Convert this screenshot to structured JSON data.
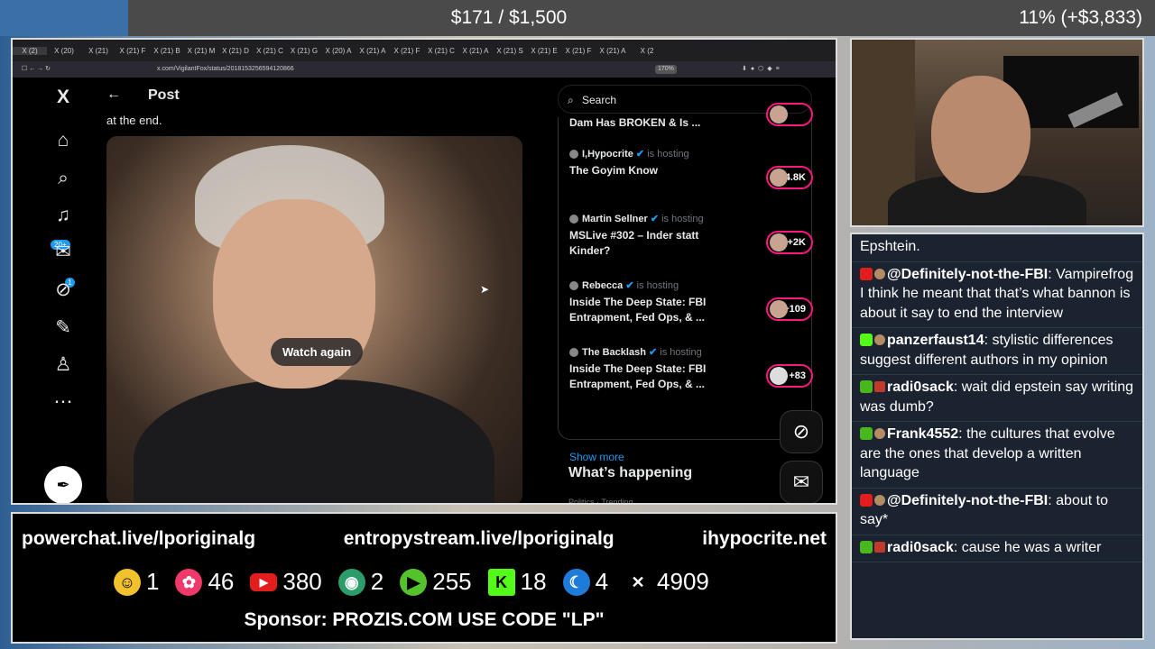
{
  "overlay": {
    "goal": "$171 / $1,500",
    "percent": "11% (+$3,833)"
  },
  "browser": {
    "tabs": [
      "X (2)",
      "X (20)",
      "X (21)",
      "X (21) F",
      "X (21) B",
      "X (21) M",
      "X (21) D",
      "X (21) C",
      "X (21) G",
      "X (20) A",
      "X (21) A",
      "X (21) F",
      "X (21) C",
      "X (21) A",
      "X (21) S",
      "X (21) E",
      "X (21) F",
      "X (21) A",
      "X (2"
    ],
    "url": "x.com/VigilantFox/status/2018153256594120866",
    "zoom": "170%"
  },
  "x": {
    "logo": "X",
    "post_title": "Post",
    "post_text_tail": "at the end.",
    "nav": {
      "notifications_badge": "20+",
      "messages_badge": "1"
    },
    "video": {
      "watch_again": "Watch again"
    },
    "search_placeholder": "Search",
    "spaces": [
      {
        "host": "",
        "hosting": "",
        "title": "Dam Has BROKEN & Is ...",
        "count": ""
      },
      {
        "host": "I,Hypocrite",
        "hosting": "is hosting",
        "title": "The Goyim Know",
        "count": "+4.8K"
      },
      {
        "host": "Martin Sellner",
        "hosting": "is hosting",
        "title": "MSLive #302 – Inder statt Kinder?",
        "count": "+2K"
      },
      {
        "host": "Rebecca",
        "hosting": "is hosting",
        "title": "Inside The Deep State: FBI Entrapment, Fed Ops, & ...",
        "count": "+109"
      },
      {
        "host": "The Backlash",
        "hosting": "is hosting",
        "title": "Inside The Deep State: FBI Entrapment, Fed Ops, & ...",
        "count": "+83"
      }
    ],
    "show_more": "Show more",
    "whats_happening": "What’s happening",
    "trending_label": "Politics · Trending"
  },
  "stream": {
    "links": [
      "powerchat.live/lporiginalg",
      "entropystream.live/lporiginalg",
      "ihypocrite.net"
    ],
    "counts": [
      {
        "platform": "powerchat",
        "value": "1",
        "color": "#f2c12e"
      },
      {
        "platform": "entropy",
        "value": "46",
        "color": "#f0386b"
      },
      {
        "platform": "youtube",
        "value": "380",
        "color": "#e21d1d"
      },
      {
        "platform": "odysee",
        "value": "2",
        "color": "#2a9d6b"
      },
      {
        "platform": "rumble",
        "value": "255",
        "color": "#53c22b"
      },
      {
        "platform": "kick",
        "value": "18",
        "color": "#53fc18"
      },
      {
        "platform": "pilled",
        "value": "4",
        "color": "#1e7bd8"
      },
      {
        "platform": "x",
        "value": "4909",
        "color": "#ffffff"
      }
    ],
    "sponsor": "Sponsor: PROZIS.COM USE CODE \"LP\""
  },
  "chat": [
    {
      "platform": "",
      "user": "",
      "text": "Epshtein."
    },
    {
      "platform": "youtube",
      "user": "@Definitely-not-the-FBI",
      "text": ": Vampirefrog I think he meant that that’s what bannon is about it say to end the interview"
    },
    {
      "platform": "kick",
      "user": "panzerfaust14",
      "text": ": stylistic differences suggest different authors in my opinion"
    },
    {
      "platform": "rumble",
      "user": "radi0sack",
      "text": ": wait did epstein say writing was dumb?"
    },
    {
      "platform": "rumble",
      "user": "Frank4552",
      "text": ": the cultures that evolve are the ones that develop a written language"
    },
    {
      "platform": "youtube",
      "user": "@Definitely-not-the-FBI",
      "text": ": about to say*"
    },
    {
      "platform": "rumble",
      "user": "radi0sack",
      "text": ": cause he was a writer"
    }
  ]
}
